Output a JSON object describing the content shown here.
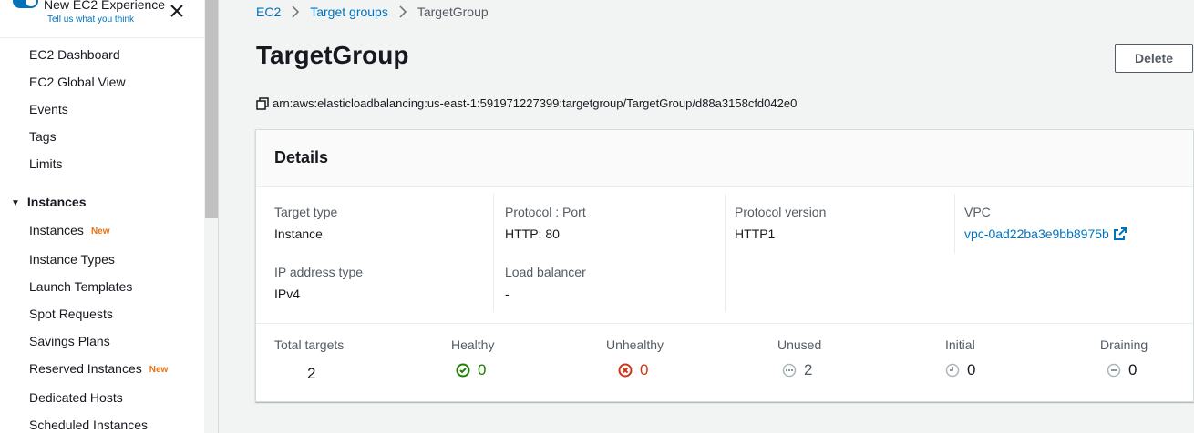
{
  "sidebar": {
    "experience_title": "New EC2 Experience",
    "experience_sub": "Tell us what you think",
    "top_items": [
      "EC2 Dashboard",
      "EC2 Global View",
      "Events",
      "Tags",
      "Limits"
    ],
    "section_instances": "Instances",
    "instance_items": [
      {
        "label": "Instances",
        "badge": "New"
      },
      {
        "label": "Instance Types",
        "badge": ""
      },
      {
        "label": "Launch Templates",
        "badge": ""
      },
      {
        "label": "Spot Requests",
        "badge": ""
      },
      {
        "label": "Savings Plans",
        "badge": ""
      },
      {
        "label": "Reserved Instances",
        "badge": "New"
      },
      {
        "label": "Dedicated Hosts",
        "badge": ""
      },
      {
        "label": "Scheduled Instances",
        "badge": ""
      }
    ]
  },
  "breadcrumb": {
    "items": [
      "EC2",
      "Target groups"
    ],
    "current": "TargetGroup"
  },
  "page": {
    "title": "TargetGroup",
    "delete_label": "Delete",
    "arn": "arn:aws:elasticloadbalancing:us-east-1:591971227399:targetgroup/TargetGroup/d88a3158cfd042e0"
  },
  "details": {
    "header": "Details",
    "target_type_label": "Target type",
    "target_type": "Instance",
    "protocol_port_label": "Protocol : Port",
    "protocol_port": "HTTP: 80",
    "protocol_version_label": "Protocol version",
    "protocol_version": "HTTP1",
    "vpc_label": "VPC",
    "vpc": "vpc-0ad22ba3e9bb8975b",
    "ip_type_label": "IP address type",
    "ip_type": "IPv4",
    "lb_label": "Load balancer",
    "lb": "-"
  },
  "stats": {
    "total_label": "Total targets",
    "total": "2",
    "healthy_label": "Healthy",
    "healthy": "0",
    "unhealthy_label": "Unhealthy",
    "unhealthy": "0",
    "unused_label": "Unused",
    "unused": "2",
    "initial_label": "Initial",
    "initial": "0",
    "draining_label": "Draining",
    "draining": "0"
  },
  "colors": {
    "link": "#0073bb",
    "healthy": "#1d8102",
    "unhealthy": "#d13212",
    "neutral": "#687078",
    "badge": "#ec7211"
  }
}
